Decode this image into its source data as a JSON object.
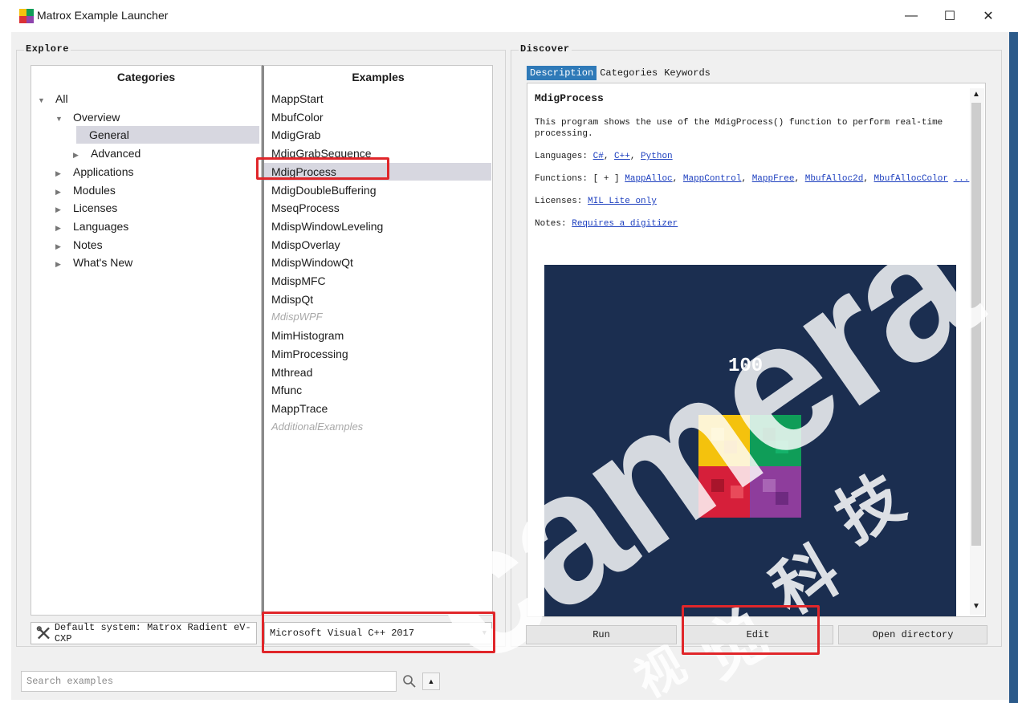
{
  "window": {
    "title": "Matrox Example Launcher",
    "min": "—",
    "max": "☐",
    "close": "✕"
  },
  "explore": {
    "title": "Explore",
    "categories_header": "Categories",
    "examples_header": "Examples",
    "tree": [
      {
        "label": "All",
        "indent": 0,
        "expanded": true
      },
      {
        "label": "Overview",
        "indent": 1,
        "expanded": true
      },
      {
        "label": "General",
        "indent": 2,
        "selected": true
      },
      {
        "label": "Advanced",
        "indent": 2
      },
      {
        "label": "Applications",
        "indent": 1
      },
      {
        "label": "Modules",
        "indent": 1
      },
      {
        "label": "Licenses",
        "indent": 1
      },
      {
        "label": "Languages",
        "indent": 1
      },
      {
        "label": "Notes",
        "indent": 1
      },
      {
        "label": "What's New",
        "indent": 1
      }
    ],
    "examples": [
      {
        "label": "MappStart"
      },
      {
        "label": "MbufColor"
      },
      {
        "label": "MdigGrab"
      },
      {
        "label": "MdigGrabSequence"
      },
      {
        "label": "MdigProcess",
        "selected": true
      },
      {
        "label": "MdigDoubleBuffering"
      },
      {
        "label": "MseqProcess"
      },
      {
        "label": "MdispWindowLeveling"
      },
      {
        "label": "MdispOverlay"
      },
      {
        "label": "MdispWindowQt"
      },
      {
        "label": "MdispMFC"
      },
      {
        "label": "MdispQt"
      },
      {
        "label": "MdispWPF",
        "disabled": true
      },
      {
        "label": "MimHistogram"
      },
      {
        "label": "MimProcessing"
      },
      {
        "label": "Mthread"
      },
      {
        "label": "Mfunc"
      },
      {
        "label": "MappTrace"
      },
      {
        "label": "AdditionalExamples",
        "disabled": true
      }
    ],
    "default_system": "Default system: Matrox Radient eV-CXP",
    "compiler": "Microsoft Visual C++ 2017"
  },
  "discover": {
    "title": "Discover",
    "tabs": [
      "Description",
      "Categories",
      "Keywords"
    ],
    "example_title": "MdigProcess",
    "description": "This program shows the use of the MdigProcess() function to perform real-time processing.",
    "languages_label": "Languages:",
    "languages": [
      "C#",
      "C++",
      "Python"
    ],
    "functions_label": "Functions:",
    "functions_prefix": "[ + ]",
    "functions": [
      "MappAlloc",
      "MappControl",
      "MappFree",
      "MbufAlloc2d",
      "MbufAllocColor",
      "..."
    ],
    "licenses_label": "Licenses:",
    "licenses": "MIL Lite only",
    "notes_label": "Notes:",
    "notes": "Requires a digitizer",
    "preview_number": "100",
    "buttons": {
      "run": "Run",
      "edit": "Edit",
      "open_directory": "Open directory"
    }
  },
  "search": {
    "placeholder": "Search examples"
  },
  "watermark": {
    "text": "camera",
    "cjk": [
      "视",
      "觉",
      "科",
      "技"
    ]
  },
  "colors": {
    "accent": "#2f7ab8",
    "highlight": "#e0262a",
    "preview_bg": "#1b2e50"
  }
}
